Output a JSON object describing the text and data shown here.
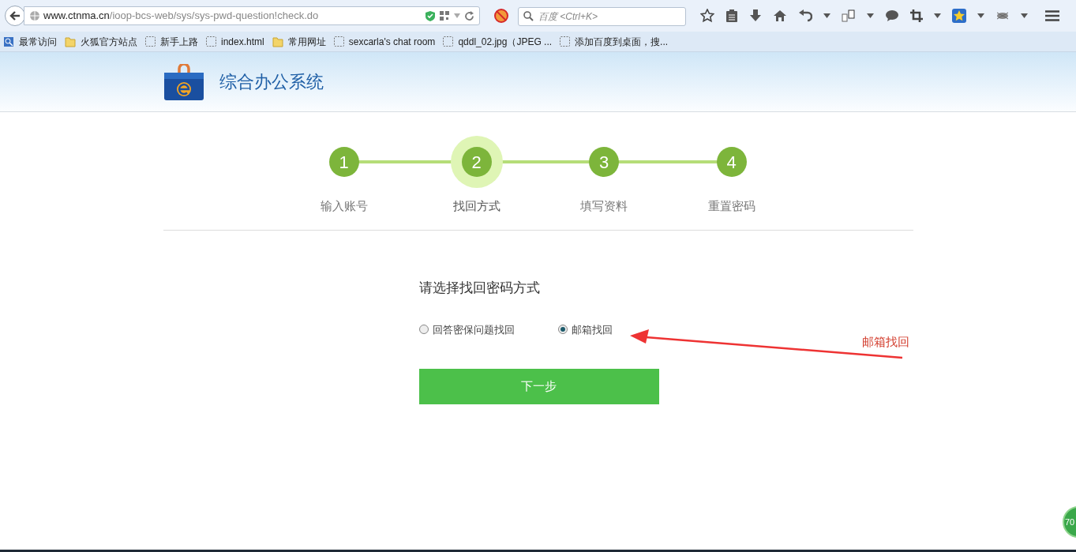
{
  "browser": {
    "url_host": "www.ctnma.cn",
    "url_path": "/ioop-bcs-web/sys/sys-pwd-question!check.do",
    "search_placeholder": "百度 <Ctrl+K>",
    "bookmarks": [
      {
        "label": "最常访问",
        "kind": "search"
      },
      {
        "label": "火狐官方站点",
        "kind": "folder"
      },
      {
        "label": "新手上路",
        "kind": "page"
      },
      {
        "label": "index.html",
        "kind": "page"
      },
      {
        "label": "常用网址",
        "kind": "folder"
      },
      {
        "label": "sexcarla's chat room",
        "kind": "page"
      },
      {
        "label": "qddl_02.jpg（JPEG ...",
        "kind": "page"
      },
      {
        "label": "添加百度到桌面，搜...",
        "kind": "page"
      }
    ]
  },
  "site": {
    "title": "综合办公系统"
  },
  "steps": [
    {
      "number": "1",
      "label": "输入账号",
      "selected": false
    },
    {
      "number": "2",
      "label": "找回方式",
      "selected": true
    },
    {
      "number": "3",
      "label": "填写资料",
      "selected": false
    },
    {
      "number": "4",
      "label": "重置密码",
      "selected": false
    }
  ],
  "form": {
    "heading": "请选择找回密码方式",
    "options": [
      {
        "label": "回答密保问题找回",
        "selected": false
      },
      {
        "label": "邮箱找回",
        "selected": true
      }
    ],
    "submit": "下一步"
  },
  "annotation": {
    "label": "邮箱找回"
  },
  "badge": {
    "label": "70"
  }
}
